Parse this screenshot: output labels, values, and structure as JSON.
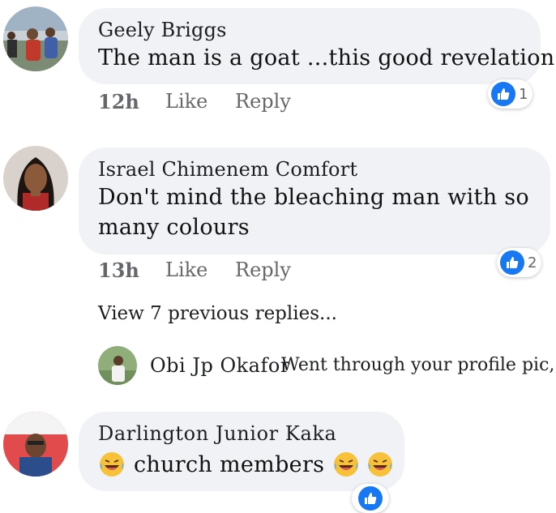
{
  "comments": [
    {
      "author": "Geely Briggs",
      "text": "The man is a goat ...this good revelation",
      "time": "12h",
      "like_label": "Like",
      "reply_label": "Reply",
      "reaction_count": "1"
    },
    {
      "author": "Israel Chimenem Comfort",
      "text_line1": "Don't mind the bleaching man with so",
      "text_line2": "many colours",
      "time": "13h",
      "like_label": "Like",
      "reply_label": "Reply",
      "reaction_count": "2"
    },
    {
      "author": "Darlington Junior Kaka",
      "text": "church members"
    }
  ],
  "replies_thread": {
    "view_previous": "View 7 previous replies...",
    "latest_reply_author": "Obi Jp Okafor",
    "latest_reply_text": "Went through your profile pic,..."
  },
  "icons": {
    "reaction": "like-thumb-icon",
    "emoji": "laughing-tears-emoji"
  },
  "colors": {
    "bubble": "#f0f2f5",
    "like_blue": "#1877f2",
    "meta_gray": "#65676b"
  }
}
